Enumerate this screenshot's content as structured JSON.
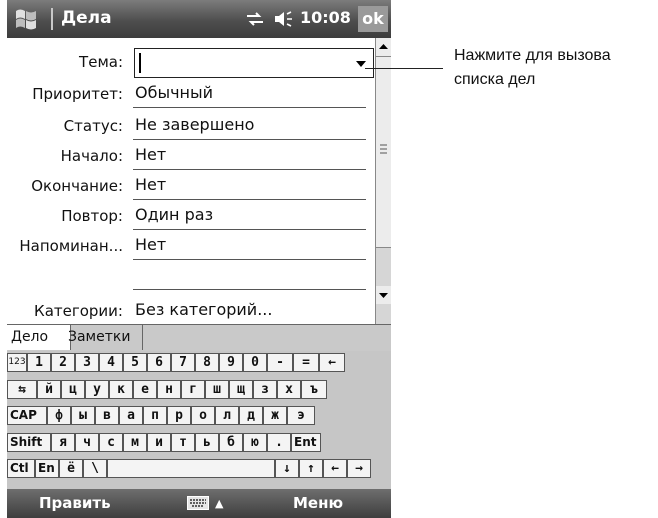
{
  "titlebar": {
    "title": "Дела",
    "time": "10:08",
    "ok_label": "ok"
  },
  "form": {
    "fields": [
      {
        "label": "Тема:",
        "value": ""
      },
      {
        "label": "Приоритет:",
        "value": "Обычный"
      },
      {
        "label": "Статус:",
        "value": "Не завершено"
      },
      {
        "label": "Начало:",
        "value": "Нет"
      },
      {
        "label": "Окончание:",
        "value": "Нет"
      },
      {
        "label": "Повтор:",
        "value": "Один раз"
      },
      {
        "label": "Напоминан...",
        "value": "Нет"
      },
      {
        "label": "",
        "value": ""
      },
      {
        "label": "Категории:",
        "value": "Без категорий..."
      }
    ]
  },
  "tabs": [
    "Дело",
    "Заметки"
  ],
  "keyboard": {
    "rows": [
      [
        "123",
        "1",
        "2",
        "3",
        "4",
        "5",
        "6",
        "7",
        "8",
        "9",
        "0",
        "-",
        "=",
        "←"
      ],
      [
        "⇆",
        "й",
        "ц",
        "у",
        "к",
        "е",
        "н",
        "г",
        "ш",
        "щ",
        "з",
        "х",
        "ъ"
      ],
      [
        "CAP",
        "ф",
        "ы",
        "в",
        "а",
        "п",
        "р",
        "о",
        "л",
        "д",
        "ж",
        "э"
      ],
      [
        "Shift",
        "я",
        "ч",
        "с",
        "м",
        "и",
        "т",
        "ь",
        "б",
        "ю",
        ".",
        "Ent"
      ],
      [
        "Ctl",
        "En",
        "ё",
        "\\",
        "",
        "↓",
        "↑",
        "←",
        "→"
      ]
    ]
  },
  "bottombar": {
    "left_label": "Править",
    "right_label": "Меню"
  },
  "callout": {
    "text": "Нажмите для вызова списка дел"
  }
}
